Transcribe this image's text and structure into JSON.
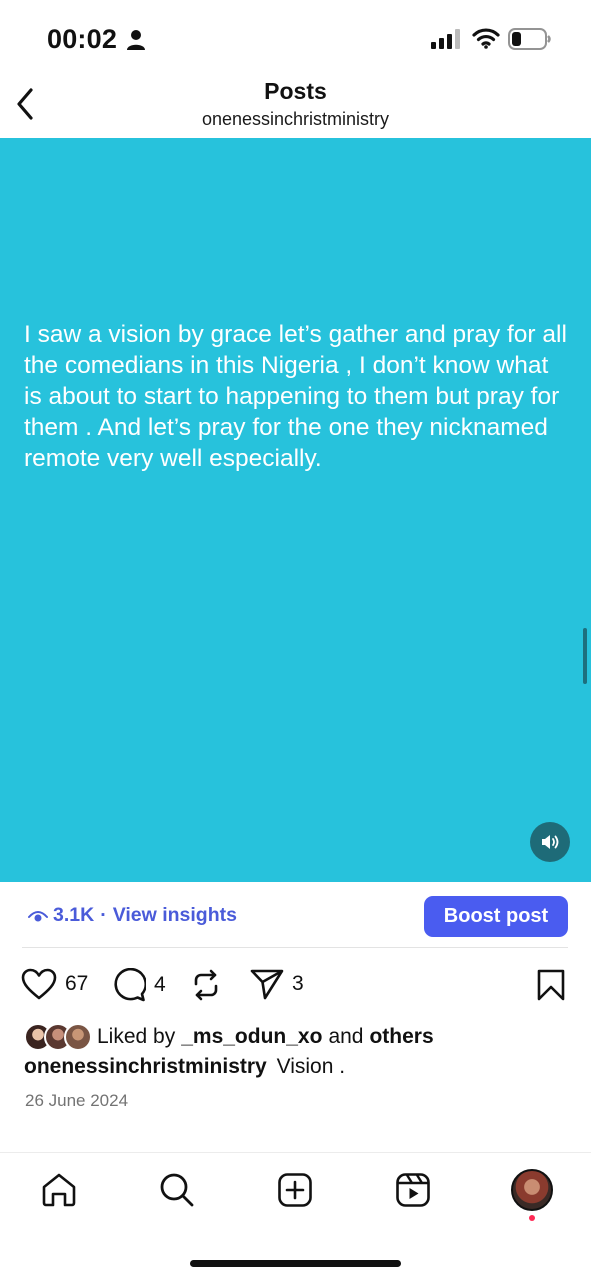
{
  "status_bar": {
    "time": "00:02",
    "icons": [
      "person-icon",
      "signal-icon",
      "wifi-icon",
      "battery-icon"
    ]
  },
  "header": {
    "title": "Posts",
    "subtitle": "onenessinchristministry",
    "back_icon": "chevron-left-icon"
  },
  "post": {
    "background_color": "#27c2dc",
    "text": "I saw a vision by grace let’s gather and pray for all the comedians in this Nigeria , I don’t know what is about to start to happening to them but pray for them . And let’s pray for the one they nicknamed remote very well especially.",
    "mute_icon": "speaker-icon"
  },
  "insights": {
    "views": "3.1K",
    "separator": "·",
    "link_label": "View insights",
    "boost_label": "Boost post",
    "accent_color": "#4a5cf0"
  },
  "actions": {
    "likes": "67",
    "comments": "4",
    "shares": "3"
  },
  "liked_by": {
    "prefix": "Liked by",
    "user": "_ms_odun_xo",
    "connector": "and",
    "others": "others"
  },
  "caption": {
    "username": "onenessinchristministry",
    "text": "Vision ."
  },
  "date": "26 June 2024",
  "bottom_nav": {
    "items": [
      "home-icon",
      "search-icon",
      "create-icon",
      "reels-icon",
      "profile-avatar"
    ],
    "notification_dot_color": "#ff2a55"
  }
}
